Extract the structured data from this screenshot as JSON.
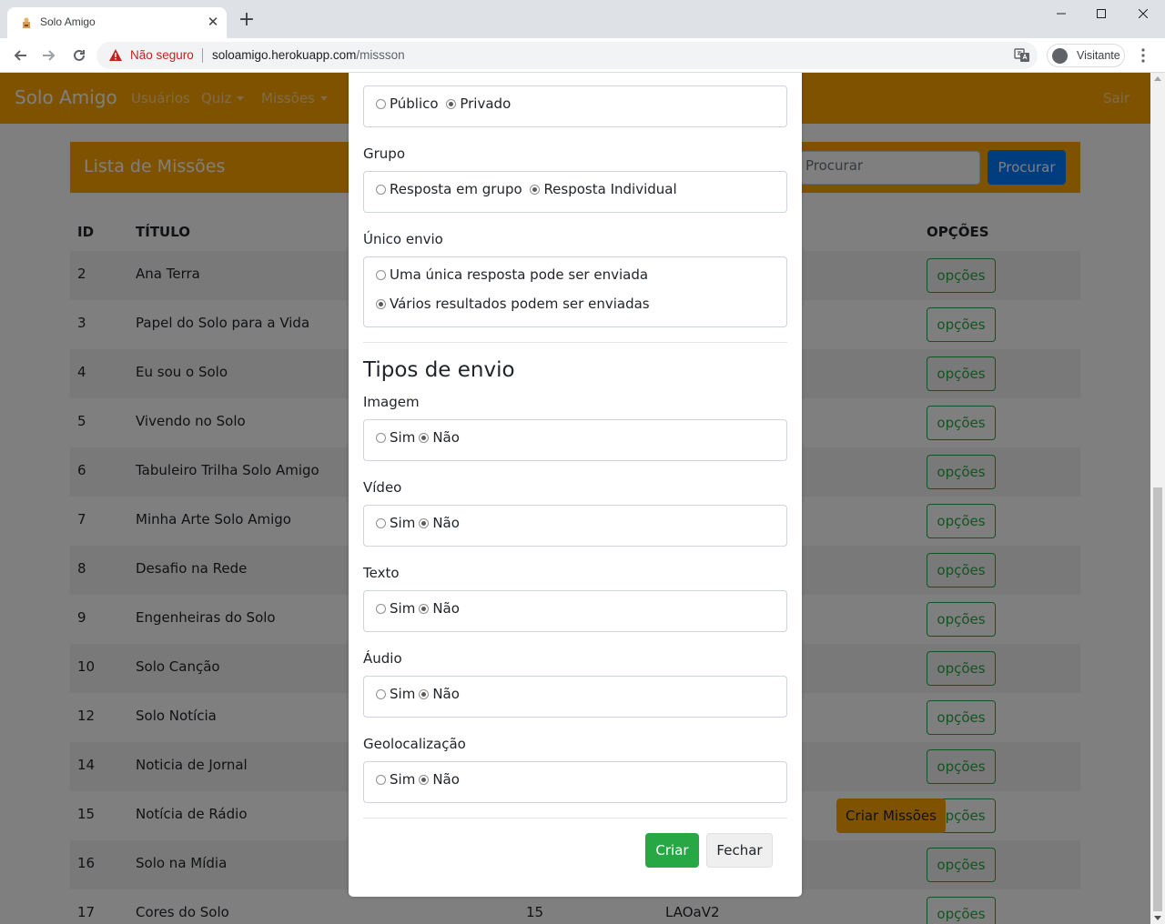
{
  "browser": {
    "tab_title": "Solo Amigo",
    "tab_close": "✕",
    "new_tab": "+",
    "security_label": "Não seguro",
    "url_host": "soloamigo.herokuapp.com",
    "url_path": "/missson",
    "profile_label": "Visitante",
    "icons": [
      "solo-amigo-favicon",
      "back-arrow-icon",
      "forward-arrow-icon",
      "reload-icon",
      "warning-icon",
      "translate-icon",
      "avatar-icon",
      "menu-dots-icon",
      "minimize-icon",
      "maximize-icon",
      "close-icon"
    ]
  },
  "navbar": {
    "brand": "Solo Amigo",
    "links": [
      "Usuários",
      "Quiz",
      "Missões",
      "Sair"
    ]
  },
  "list": {
    "title": "Lista de Missões",
    "search_placeholder": "Procurar",
    "search_button": "Procurar",
    "headers": {
      "id": "ID",
      "title": "TÍTULO",
      "options": "OPÇÕES"
    },
    "options_label": "opções",
    "rows": [
      {
        "id": "2",
        "title": "Ana Terra"
      },
      {
        "id": "3",
        "title": "Papel do Solo para a Vida"
      },
      {
        "id": "4",
        "title": "Eu sou o Solo"
      },
      {
        "id": "5",
        "title": "Vivendo no Solo"
      },
      {
        "id": "6",
        "title": "Tabuleiro Trilha Solo Amigo"
      },
      {
        "id": "7",
        "title": "Minha Arte Solo Amigo"
      },
      {
        "id": "8",
        "title": "Desafio na Rede"
      },
      {
        "id": "9",
        "title": "Engenheiras do Solo"
      },
      {
        "id": "10",
        "title": "Solo Canção"
      },
      {
        "id": "12",
        "title": "Solo Notícia"
      },
      {
        "id": "14",
        "title": "Noticia de Jornal"
      },
      {
        "id": "15",
        "title": "Notícia de Rádio"
      },
      {
        "id": "16",
        "title": "Solo na Mídia"
      },
      {
        "id": "17",
        "title": "Cores do Solo",
        "col3": "15",
        "col4": "LAOaV2"
      }
    ],
    "create_button": "Criar Missões"
  },
  "modal": {
    "visibility": {
      "options": [
        "Público",
        "Privado"
      ],
      "selected": "Privado"
    },
    "group": {
      "label": "Grupo",
      "options": [
        "Resposta em grupo",
        "Resposta Individual"
      ],
      "selected": "Resposta Individual"
    },
    "single_send": {
      "label": "Único envio",
      "options": [
        "Uma única resposta pode ser enviada",
        "Vários resultados podem ser enviadas"
      ],
      "selected": "Vários resultados podem ser enviadas"
    },
    "section_title": "Tipos de envio",
    "submission_types": [
      {
        "label": "Imagem",
        "yes": "Sim",
        "no": "Não",
        "selected": "Não"
      },
      {
        "label": "Vídeo",
        "yes": "Sim",
        "no": "Não",
        "selected": "Não"
      },
      {
        "label": "Texto",
        "yes": "Sim",
        "no": "Não",
        "selected": "Não"
      },
      {
        "label": "Áudio",
        "yes": "Sim",
        "no": "Não",
        "selected": "Não"
      },
      {
        "label": "Geolocalização",
        "yes": "Sim",
        "no": "Não",
        "selected": "Não"
      }
    ],
    "create_button": "Criar",
    "close_button": "Fechar"
  },
  "colors": {
    "brand_orange": "#ffa500",
    "primary_blue": "#007bff",
    "success_green": "#28a745",
    "warning_red": "#c5221f"
  }
}
